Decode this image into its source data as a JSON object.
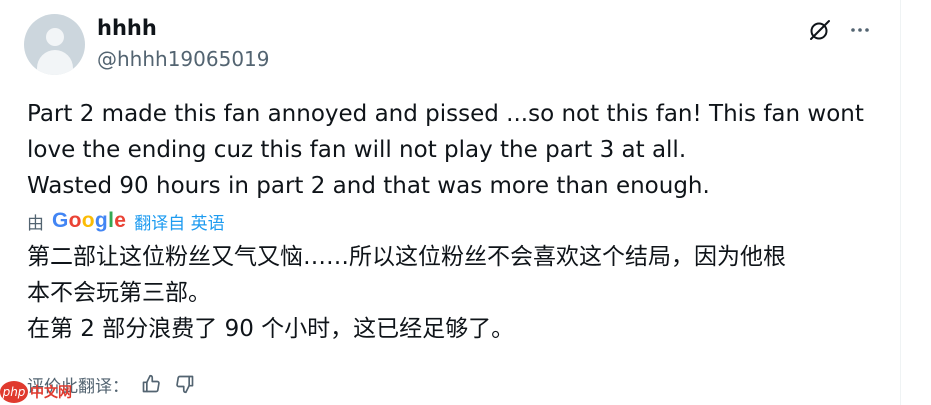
{
  "tweet": {
    "display_name": "hhhh",
    "handle": "@hhhh19065019",
    "original_lines": [
      "Part 2 made this fan annoyed and pissed ...so not this fan! This fan wont",
      "love the ending cuz this fan will not play the part 3 at all.",
      "Wasted 90 hours in part 2 and that was more than enough."
    ],
    "translation_by": "由",
    "google_label": "Google",
    "translated_from": "翻译自 英语",
    "translated_lines": [
      "第二部让这位粉丝又气又恼……所以这位粉丝不会喜欢这个结局，因为他根",
      "本不会玩第三部。",
      "在第 2 部分浪费了 90 个小时，这已经足够了。"
    ],
    "rate_label": "评价此翻译："
  },
  "icons": {
    "no_sign": "grok-slash-icon",
    "more": "more-icon",
    "thumbs_up": "thumbs-up-icon",
    "thumbs_down": "thumbs-down-icon"
  },
  "watermark": {
    "logo_text": "php",
    "text": "中文网"
  }
}
